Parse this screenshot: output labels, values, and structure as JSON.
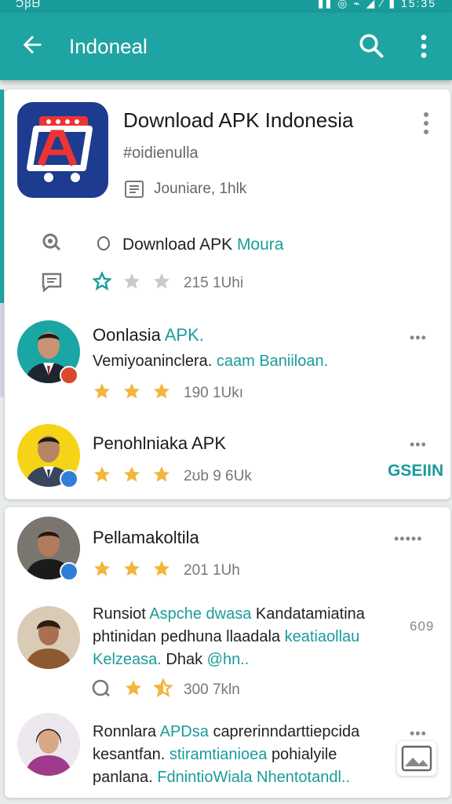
{
  "status": {
    "left": "Ͻꞵᗷ",
    "right": "▮▮ ◎ ⌁ ◢ ⁄ ▮ 15:35"
  },
  "appbar": {
    "title": "Indoneal"
  },
  "app": {
    "title": "Download APK Indonesia",
    "developer": "#oidienulla",
    "meta": "Jouniare, 1hlk",
    "download_prefix": "Download APK",
    "download_suffix": "Moura",
    "rating_meta": "215 1Uhi"
  },
  "reviews": [
    {
      "name_prefix": "Oonlasia",
      "name_suffix": "APK.",
      "line1_prefix": "Vemiyoaninclera.",
      "line1_suffix": "caam Baniiloan.",
      "meta": "190 1Ukı"
    },
    {
      "name": "Penohlniaka APK",
      "meta": "2ʊb 9 6Uk",
      "action": "GSEIIN"
    },
    {
      "name": "Pellamakoltila",
      "meta": "201 1Uh"
    },
    {
      "line1_a": "Runsiot",
      "line1_b": "Aspche dwasa",
      "line1_c": "Kandatamiatina",
      "line2_a": "phtinidan pedhuna llaadala",
      "line2_b": "keatiaollau",
      "line3_a": "Kelzeasa.",
      "line3_b": "Dhak",
      "line3_c": "@hn..",
      "meta": "300 7kln",
      "side": "609"
    },
    {
      "line1_a": "Ronnlara",
      "line1_b": "APDsa",
      "line1_c": "caprerinndarttiepcida",
      "line2_a": "kesantfan.",
      "line2_b": "stiramtianioea",
      "line2_c": "pohialyile",
      "line3_a": "panlana.",
      "line3_b": "FdnintioWiala Nhentotandl.."
    }
  ],
  "colors": {
    "accent": "#1ea4a2",
    "star": "#f2b63c",
    "star_empty": "#c9c9c9"
  },
  "icons": [
    "back-arrow-icon",
    "search-icon",
    "more-vert-icon",
    "app-logo-icon",
    "list-icon",
    "location-icon",
    "chat-icon",
    "star-icon",
    "verified-badge-icon",
    "image-icon"
  ]
}
